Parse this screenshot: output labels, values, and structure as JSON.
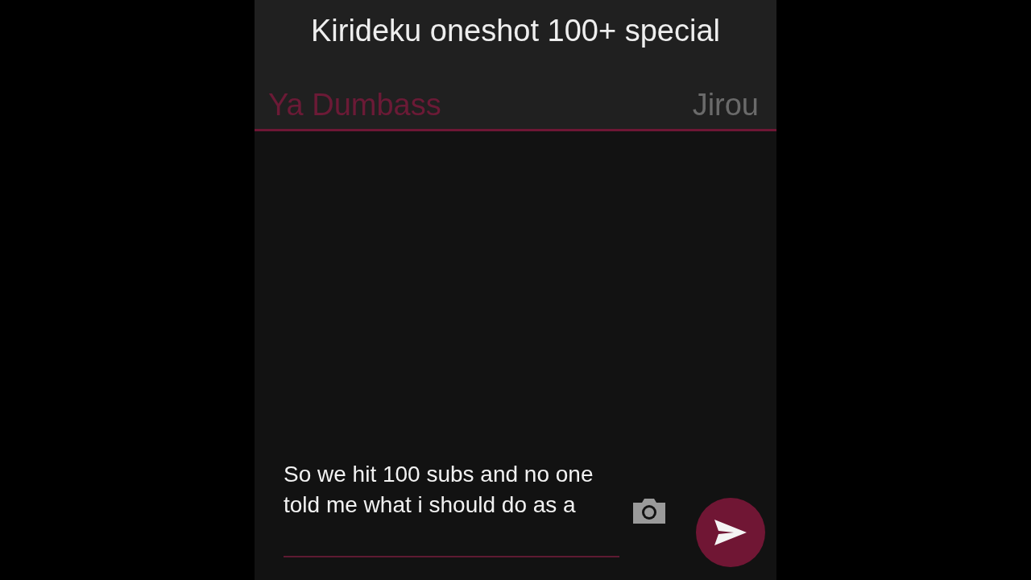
{
  "title": "Kirideku oneshot 100+ special",
  "characters": [
    {
      "name": "Ya Dumbass",
      "selected": true
    },
    {
      "name": "Jirou",
      "selected": false
    }
  ],
  "composer": {
    "value": "So we hit 100 subs and no one told me what i should do as a"
  }
}
